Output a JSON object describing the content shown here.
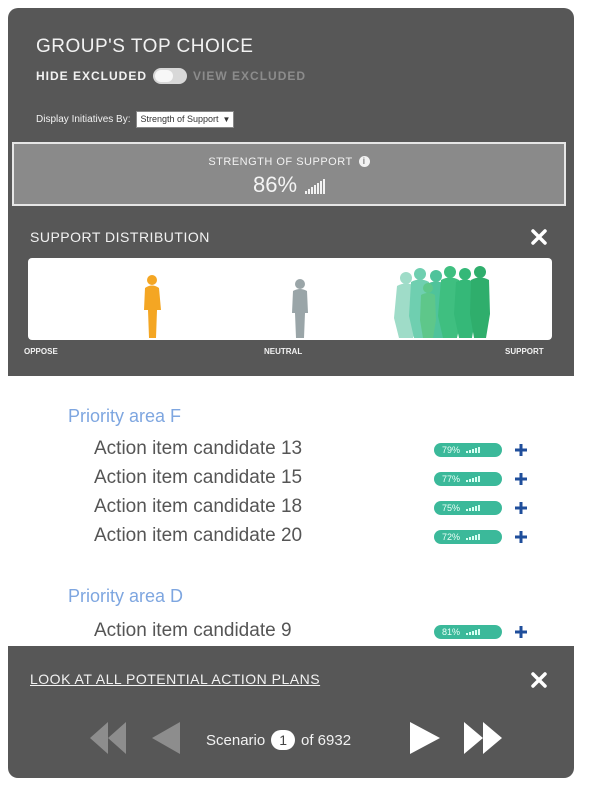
{
  "header": {
    "title": "GROUP'S TOP CHOICE",
    "hide_excluded": "HIDE EXCLUDED",
    "view_excluded": "VIEW EXCLUDED",
    "display_label": "Display Initiatives By:",
    "display_select": "Strength of Support"
  },
  "strength": {
    "label": "STRENGTH OF SUPPORT",
    "value": "86%",
    "info_icon": "info-icon"
  },
  "distribution": {
    "title": "SUPPORT DISTRIBUTION",
    "oppose": "OPPOSE",
    "neutral": "NEUTRAL",
    "support": "SUPPORT",
    "colors": {
      "oppose": "#f4a623",
      "neutral": "#9aa5a8",
      "support": "#3fbf80"
    }
  },
  "priority_areas": [
    {
      "title": "Priority area F",
      "items": [
        {
          "label": "Action item candidate 13",
          "pct": "79%"
        },
        {
          "label": "Action item candidate 15",
          "pct": "77%"
        },
        {
          "label": "Action item candidate 18",
          "pct": "75%"
        },
        {
          "label": "Action item candidate 20",
          "pct": "72%"
        }
      ]
    },
    {
      "title": "Priority area D",
      "items": [
        {
          "label": "Action item candidate 9",
          "pct": "81%"
        }
      ]
    }
  ],
  "footer": {
    "look_link": "LOOK AT ALL POTENTIAL ACTION PLANS",
    "scenario_label": "Scenario",
    "scenario_num": "1",
    "scenario_total": "of 6932"
  },
  "colors": {
    "accent": "#3bb99a",
    "plus": "#1f4e9b",
    "area_title": "#7ea6e0",
    "panel": "#575757"
  }
}
